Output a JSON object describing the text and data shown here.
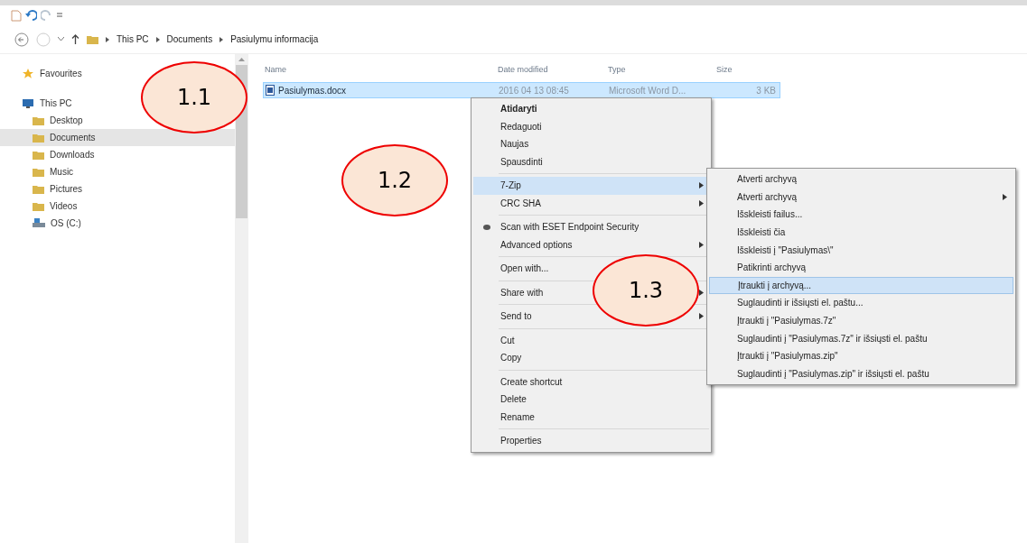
{
  "breadcrumb": [
    "This PC",
    "Documents",
    "Pasiulymu informacija"
  ],
  "nav": [
    {
      "label": "Favourites",
      "selected": false
    },
    {
      "label": "This PC",
      "selected": false,
      "children": [
        {
          "label": "Desktop",
          "selected": false
        },
        {
          "label": "Documents",
          "selected": true
        },
        {
          "label": "Downloads",
          "selected": false
        },
        {
          "label": "Music",
          "selected": false
        },
        {
          "label": "Pictures",
          "selected": false
        },
        {
          "label": "Videos",
          "selected": false
        },
        {
          "label": "OS (C:)",
          "selected": false
        }
      ]
    }
  ],
  "columns": [
    "Name",
    "Date modified",
    "Type",
    "Size"
  ],
  "files": [
    {
      "name": "Pasiulymas.docx",
      "date": "2016 04 13 08:45",
      "type": "Microsoft Word D...",
      "size": "3 KB",
      "selected": true
    }
  ],
  "context_menu": [
    {
      "kind": "item",
      "label": "Atidaryti",
      "bold": true,
      "submenu": false,
      "selected": false
    },
    {
      "kind": "item",
      "label": "Redaguoti",
      "bold": false,
      "submenu": false,
      "selected": false
    },
    {
      "kind": "item",
      "label": "Naujas",
      "bold": false,
      "submenu": false,
      "selected": false
    },
    {
      "kind": "item",
      "label": "Spausdinti",
      "bold": false,
      "submenu": false,
      "selected": false
    },
    {
      "kind": "separator"
    },
    {
      "kind": "item",
      "label": "7-Zip",
      "bold": false,
      "submenu": true,
      "selected": true
    },
    {
      "kind": "item",
      "label": "CRC SHA",
      "bold": false,
      "submenu": true,
      "selected": false
    },
    {
      "kind": "separator"
    },
    {
      "kind": "item",
      "label": "Scan with ESET Endpoint Security",
      "bold": false,
      "submenu": false,
      "selected": false,
      "icon": true
    },
    {
      "kind": "item",
      "label": "Advanced options",
      "bold": false,
      "submenu": true,
      "selected": false
    },
    {
      "kind": "separator"
    },
    {
      "kind": "item",
      "label": "Open with...",
      "bold": false,
      "submenu": false,
      "selected": false
    },
    {
      "kind": "separator"
    },
    {
      "kind": "item",
      "label": "Share with",
      "bold": false,
      "submenu": true,
      "selected": false
    },
    {
      "kind": "separator"
    },
    {
      "kind": "item",
      "label": "Send to",
      "bold": false,
      "submenu": true,
      "selected": false
    },
    {
      "kind": "separator"
    },
    {
      "kind": "item",
      "label": "Cut",
      "bold": false,
      "submenu": false,
      "selected": false
    },
    {
      "kind": "item",
      "label": "Copy",
      "bold": false,
      "submenu": false,
      "selected": false
    },
    {
      "kind": "separator"
    },
    {
      "kind": "item",
      "label": "Create shortcut",
      "bold": false,
      "submenu": false,
      "selected": false
    },
    {
      "kind": "item",
      "label": "Delete",
      "bold": false,
      "submenu": false,
      "selected": false
    },
    {
      "kind": "item",
      "label": "Rename",
      "bold": false,
      "submenu": false,
      "selected": false
    },
    {
      "kind": "separator"
    },
    {
      "kind": "item",
      "label": "Properties",
      "bold": false,
      "submenu": false,
      "selected": false
    }
  ],
  "submenu": [
    {
      "label": "Atverti archyvą",
      "submenu": false,
      "selected": false
    },
    {
      "label": "Atverti archyvą",
      "submenu": true,
      "selected": false
    },
    {
      "label": "Išskleisti failus...",
      "submenu": false,
      "selected": false
    },
    {
      "label": "Išskleisti čia",
      "submenu": false,
      "selected": false
    },
    {
      "label": "Išskleisti į \"Pasiulymas\\\"",
      "submenu": false,
      "selected": false
    },
    {
      "label": "Patikrinti archyvą",
      "submenu": false,
      "selected": false
    },
    {
      "label": "Įtraukti į archyvą...",
      "submenu": false,
      "selected": true
    },
    {
      "label": "Suglaudinti ir išsiųsti el. paštu...",
      "submenu": false,
      "selected": false
    },
    {
      "label": "Įtraukti į \"Pasiulymas.7z\"",
      "submenu": false,
      "selected": false
    },
    {
      "label": "Suglaudinti į \"Pasiulymas.7z\" ir išsiųsti el. paštu",
      "submenu": false,
      "selected": false
    },
    {
      "label": "Įtraukti į \"Pasiulymas.zip\"",
      "submenu": false,
      "selected": false
    },
    {
      "label": "Suglaudinti į \"Pasiulymas.zip\" ir išsiųsti el. paštu",
      "submenu": false,
      "selected": false
    }
  ],
  "callouts": [
    {
      "label": "1.1"
    },
    {
      "label": "1.2"
    },
    {
      "label": "1.3"
    }
  ]
}
